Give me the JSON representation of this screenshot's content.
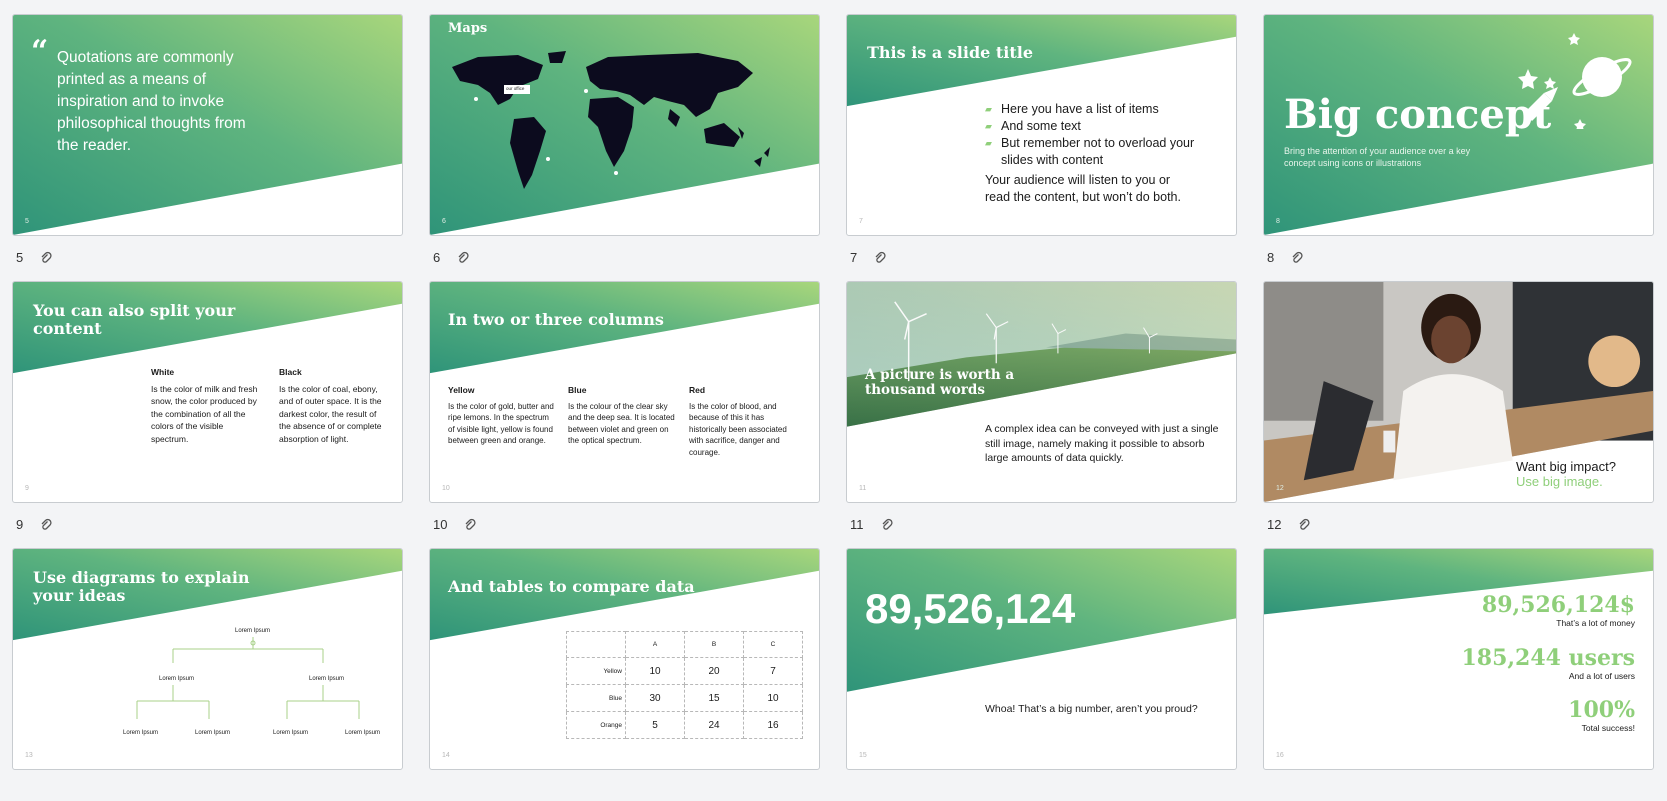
{
  "colors": {
    "band_start": "#3a9a7d",
    "band_end": "#a2d47c",
    "accent": "#8fcf7a"
  },
  "slides": [
    {
      "n": "5",
      "quote": "Quotations are commonly printed as a means of inspiration and to invoke philosophical thoughts from the reader."
    },
    {
      "n": "6",
      "title": "Maps",
      "marker": "our office"
    },
    {
      "n": "7",
      "title": "This is a slide title",
      "bullets": [
        "Here you have a list of items",
        "And some text",
        "But remember not to overload your slides with content"
      ],
      "body": "Your audience will listen to you or read the content, but won’t do both."
    },
    {
      "n": "8",
      "title": "Big concept",
      "sub": "Bring the attention of your audience over a key concept using icons or illustrations"
    },
    {
      "n": "9",
      "title": "You can also split your content",
      "cols": [
        {
          "h": "White",
          "t": "Is the color of milk and fresh snow, the color produced by the combination of all the colors of the visible spectrum."
        },
        {
          "h": "Black",
          "t": "Is the color of coal, ebony, and of outer space. It is the darkest color, the result of the absence of or complete absorption of light."
        }
      ]
    },
    {
      "n": "10",
      "title": "In two or three columns",
      "cols": [
        {
          "h": "Yellow",
          "t": "Is the color of gold, butter and ripe lemons. In the spectrum of visible light, yellow is found between green and orange."
        },
        {
          "h": "Blue",
          "t": "Is the colour of the clear sky and the deep sea. It is located between violet and green on the optical spectrum."
        },
        {
          "h": "Red",
          "t": "Is the color of blood, and because of this it has historically been associated with sacrifice, danger and courage."
        }
      ]
    },
    {
      "n": "11",
      "title": "A picture is worth a thousand words",
      "body": "A complex idea can be conveyed with just a single still image, namely making it possible to absorb large amounts of data quickly."
    },
    {
      "n": "12",
      "line1": "Want big impact?",
      "line2": "Use big image."
    },
    {
      "n": "13",
      "title": "Use diagrams to explain your ideas",
      "nodes": [
        "Lorem Ipsum",
        "Lorem Ipsum",
        "Lorem Ipsum",
        "Lorem Ipsum",
        "Lorem Ipsum",
        "Lorem Ipsum",
        "Lorem Ipsum"
      ]
    },
    {
      "n": "14",
      "title": "And tables to compare data",
      "table": {
        "headers": [
          "A",
          "B",
          "C"
        ],
        "rows": [
          {
            "label": "Yellow",
            "vals": [
              "10",
              "20",
              "7"
            ]
          },
          {
            "label": "Blue",
            "vals": [
              "30",
              "15",
              "10"
            ]
          },
          {
            "label": "Orange",
            "vals": [
              "5",
              "24",
              "16"
            ]
          }
        ]
      }
    },
    {
      "n": "15",
      "big": "89,526,124",
      "body": "Whoa! That’s a big number, aren’t you proud?"
    },
    {
      "n": "16",
      "stats": [
        {
          "v": "89,526,124$",
          "l": "That’s a lot of money"
        },
        {
          "v": "185,244 users",
          "l": "And a lot of users"
        },
        {
          "v": "100%",
          "l": "Total success!"
        }
      ]
    }
  ]
}
